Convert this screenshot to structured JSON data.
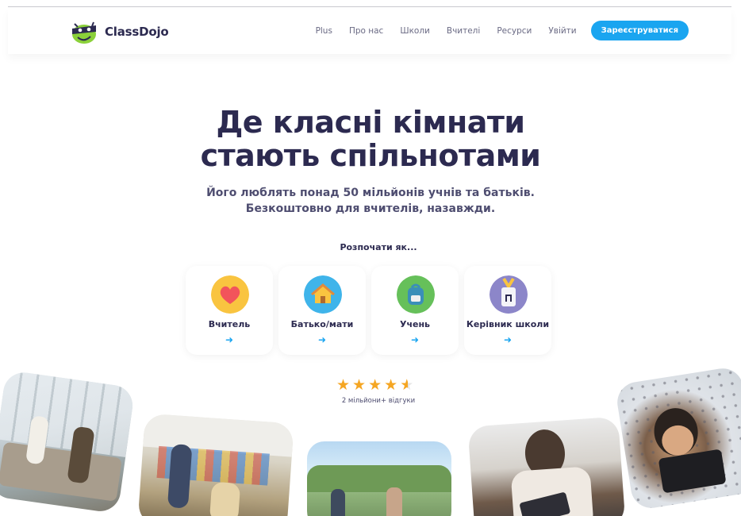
{
  "header": {
    "brand": "ClassDojo",
    "nav": [
      "Plus",
      "Про нас",
      "Школи",
      "Вчителі",
      "Ресурси",
      "Увійти"
    ],
    "signup_label": "Зареєструватися"
  },
  "hero": {
    "title_line1": "Де класні кімнати",
    "title_line2": "стають спільнотами",
    "subtitle_line1": "Його люблять понад 50 мільйонів учнів та батьків.",
    "subtitle_line2": "Безкоштовно для вчителів, назавжди."
  },
  "start": {
    "label": "Розпочати як...",
    "cards": [
      {
        "label": "Вчитель",
        "icon": "heart-icon",
        "color": "#f9c440"
      },
      {
        "label": "Батько/мати",
        "icon": "house-icon",
        "color": "#3fb4ea"
      },
      {
        "label": "Учень",
        "icon": "backpack-icon",
        "color": "#66c05a"
      },
      {
        "label": "Керівник школи",
        "icon": "badge-icon",
        "color": "#8c86c9"
      }
    ],
    "arrow": "➜"
  },
  "rating": {
    "stars": 4.5,
    "reviews": "2 мільйони+ відгуки"
  },
  "colors": {
    "primary": "#1aa5f0",
    "text": "#2c2a50",
    "star": "#f5a623"
  }
}
